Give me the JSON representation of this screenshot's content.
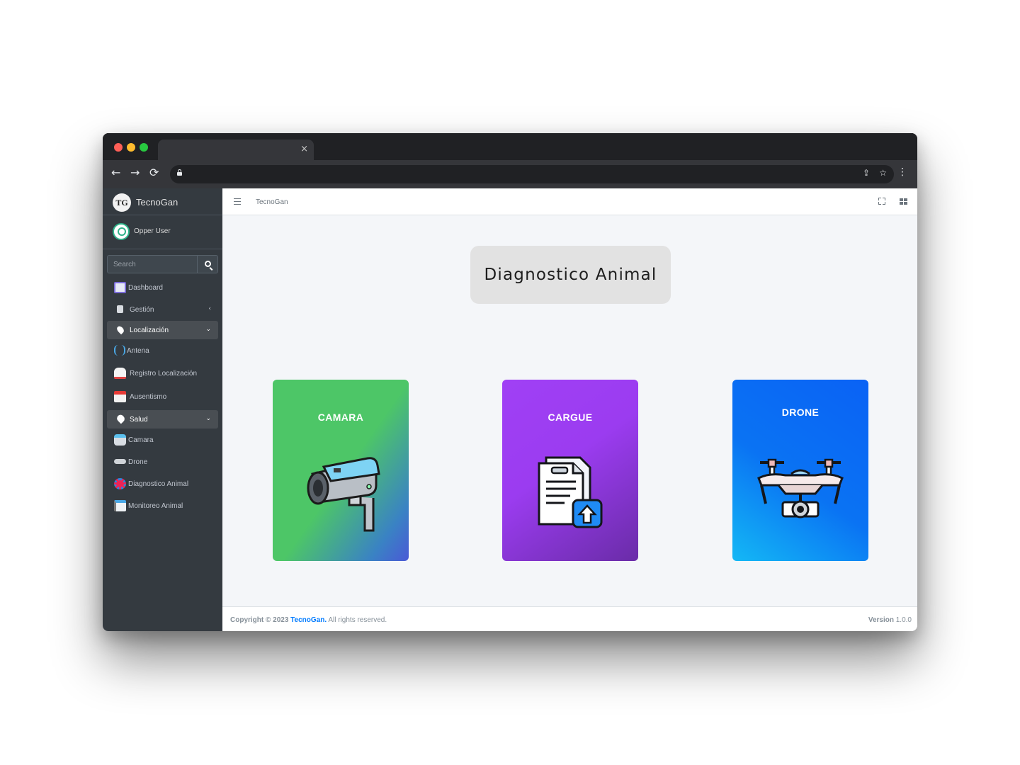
{
  "browser": {
    "tab_close": "×",
    "back": "←",
    "forward": "→",
    "reload": "⟳",
    "share": "⇪",
    "star": "☆",
    "menu": "⋮"
  },
  "sidebar": {
    "brand_logo": "TG",
    "brand": "TecnoGan",
    "user": "Opper User",
    "search_placeholder": "Search",
    "items": [
      {
        "label": "Dashboard",
        "icon": "dashboard-icon"
      },
      {
        "label": "Gestión",
        "icon": "clipboard-icon",
        "chevron": "‹"
      },
      {
        "label": "Localización",
        "icon": "map-marker-icon",
        "chevron": "⌄",
        "active": true
      },
      {
        "label": "Antena",
        "icon": "antenna-icon"
      },
      {
        "label": "Registro Localización",
        "icon": "cow-location-icon"
      },
      {
        "label": "Ausentismo",
        "icon": "calendar-icon"
      },
      {
        "label": "Salud",
        "icon": "heartbeat-icon",
        "chevron": "⌄",
        "active": true
      },
      {
        "label": "Camara",
        "icon": "camera-icon"
      },
      {
        "label": "Drone",
        "icon": "drone-icon"
      },
      {
        "label": "Diagnostico Animal",
        "icon": "virus-icon"
      },
      {
        "label": "Monitoreo Animal",
        "icon": "monitor-camera-icon"
      }
    ]
  },
  "topnav": {
    "brand": "TecnoGan"
  },
  "page": {
    "title": "Diagnostico Animal"
  },
  "cards": [
    {
      "label": "CAMARA",
      "icon": "security-camera-icon",
      "colors": [
        "#4dc667",
        "#4a59d6"
      ]
    },
    {
      "label": "CARGUE",
      "icon": "document-upload-icon",
      "colors": [
        "#a040f5",
        "#6a2ca8"
      ]
    },
    {
      "label": "DRONE",
      "icon": "drone-camera-icon",
      "colors": [
        "#0a62f5",
        "#14b8f5"
      ]
    }
  ],
  "footer": {
    "copyright": "Copyright © 2023",
    "brand": "TecnoGan.",
    "rights": "All rights reserved.",
    "version_label": "Version",
    "version": "1.0.0"
  },
  "colors": {
    "sidebar_bg": "#343a40",
    "content_bg": "#f4f6f9",
    "link": "#007bff"
  }
}
